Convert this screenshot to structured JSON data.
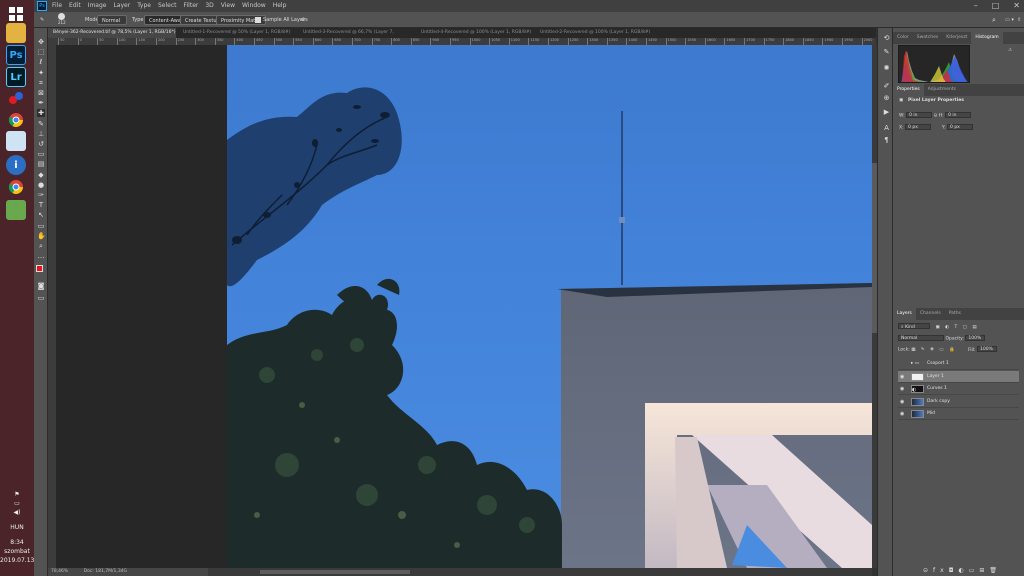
{
  "taskbar": {
    "apps": [
      {
        "name": "windows-start-icon"
      },
      {
        "name": "file-explorer-icon"
      },
      {
        "name": "photoshop-app-icon",
        "label": "Ps"
      },
      {
        "name": "lightroom-app-icon",
        "label": "Lr"
      },
      {
        "name": "app-icon"
      },
      {
        "name": "chrome-icon"
      },
      {
        "name": "notepad-icon"
      },
      {
        "name": "info-app-icon",
        "label": "i"
      },
      {
        "name": "chrome-icon"
      },
      {
        "name": "remote-app-icon"
      }
    ],
    "lang": "HUN",
    "time": "8:34",
    "day": "szombat",
    "date": "2019.07.13."
  },
  "menubar": {
    "items": [
      "File",
      "Edit",
      "Image",
      "Layer",
      "Type",
      "Select",
      "Filter",
      "3D",
      "View",
      "Window",
      "Help"
    ]
  },
  "options": {
    "brush_size": "212",
    "mode_label": "Mode:",
    "mode_value": "Normal",
    "type_label": "Type:",
    "content_aware": "Content-Aware",
    "create_texture": "Create Texture",
    "proximity_match": "Proximity Match",
    "sample_all": "Sample All Layers"
  },
  "doc_tabs": [
    {
      "label": "Bényei-362-Recovered.tif @ 78,5% (Layer 1, RGB/16*) *",
      "active": true
    },
    {
      "label": "Untitled-1-Recovered @ 50% (Layer 1, RGB/8#) *",
      "active": false
    },
    {
      "label": "Untitled-3-Recovered @ 66,7% (Layer 7, RGB/8#) *",
      "active": false
    },
    {
      "label": "Untitled-4-Recovered @ 100% (Layer 1, RGB/8#) *",
      "active": false
    },
    {
      "label": "Untitled-2-Recovered @ 100% (Layer 1, RGB/8#) *",
      "active": false
    }
  ],
  "ruler_ticks": [
    "50",
    "0",
    "50",
    "100",
    "150",
    "200",
    "250",
    "300",
    "350",
    "400",
    "450",
    "500",
    "550",
    "600",
    "650",
    "700",
    "750",
    "800",
    "850",
    "900",
    "950",
    "1000",
    "1050",
    "1100",
    "1150",
    "1200",
    "1250",
    "1300",
    "1350",
    "1400",
    "1450",
    "1500",
    "1550",
    "1600",
    "1650",
    "1700",
    "1750",
    "1800",
    "1850",
    "1900",
    "1950",
    "2000"
  ],
  "status": {
    "zoom": "78,46%",
    "doc": "Doc: 181,7M/1,34G"
  },
  "panel_top": {
    "tabs": [
      "Color",
      "Swatches",
      "Kiterjeszt",
      "Histogram"
    ],
    "active": "Histogram"
  },
  "properties": {
    "tabs": [
      "Properties",
      "Adjustments"
    ],
    "title": "Pixel Layer Properties",
    "w_label": "W:",
    "w_value": "0 in",
    "h_label": "H:",
    "h_value": "0 in",
    "x_label": "X:",
    "x_value": "0 px",
    "y_label": "Y:",
    "y_value": "0 px"
  },
  "layers_panel": {
    "tabs": [
      "Layers",
      "Channels",
      "Paths"
    ],
    "kind": "Kind",
    "blend": "Normal",
    "opacity_label": "Opacity:",
    "opacity": "100%",
    "lock_label": "Lock:",
    "fill_label": "Fill:",
    "fill": "100%",
    "layers": [
      {
        "name": "Csoport 1",
        "type": "group"
      },
      {
        "name": "Layer 1",
        "type": "pixel",
        "selected": true
      },
      {
        "name": "Curves 1",
        "type": "adjustment"
      },
      {
        "name": "Dark copy",
        "type": "pixel"
      },
      {
        "name": "Mid",
        "type": "pixel"
      }
    ]
  },
  "colors": {
    "foreground": "#e8121c",
    "background": "#ffffff",
    "sky": "#4485db"
  }
}
